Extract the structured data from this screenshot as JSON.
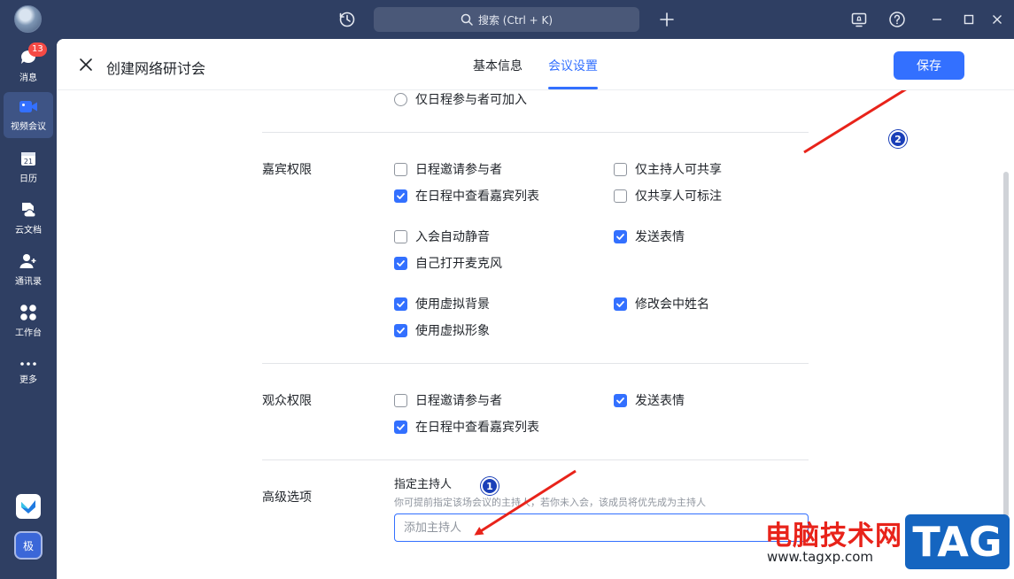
{
  "titlebar": {
    "search_label": "搜索 (Ctrl + K)"
  },
  "sidebar": {
    "badge_count": "13",
    "items": [
      {
        "label": "消息",
        "icon": "chat-icon"
      },
      {
        "label": "视频会议",
        "icon": "video-icon"
      },
      {
        "label": "日历",
        "icon": "calendar-icon"
      },
      {
        "label": "云文档",
        "icon": "cloud-doc-icon"
      },
      {
        "label": "通讯录",
        "icon": "contacts-icon"
      },
      {
        "label": "工作台",
        "icon": "apps-grid-icon"
      },
      {
        "label": "更多",
        "icon": "more-icon"
      }
    ],
    "app_tile_2_label": "极"
  },
  "header": {
    "title": "创建网络研讨会",
    "tabs": [
      {
        "label": "基本信息",
        "active": false
      },
      {
        "label": "会议设置",
        "active": true
      }
    ],
    "save_label": "保存"
  },
  "settings": {
    "top_radio_label": "仅日程参与者可加入",
    "guest": {
      "label": "嘉宾权限",
      "options": [
        {
          "label": "日程邀请参与者",
          "checked": false
        },
        {
          "label": "仅主持人可共享",
          "checked": false
        },
        {
          "label": "在日程中查看嘉宾列表",
          "checked": true
        },
        {
          "label": "仅共享人可标注",
          "checked": false
        },
        {
          "label": "入会自动静音",
          "checked": false
        },
        {
          "label": "发送表情",
          "checked": true
        },
        {
          "label": "自己打开麦克风",
          "checked": true
        },
        {
          "label": "使用虚拟背景",
          "checked": true
        },
        {
          "label": "修改会中姓名",
          "checked": true
        },
        {
          "label": "使用虚拟形象",
          "checked": true
        }
      ]
    },
    "audience": {
      "label": "观众权限",
      "options": [
        {
          "label": "日程邀请参与者",
          "checked": false
        },
        {
          "label": "发送表情",
          "checked": true
        },
        {
          "label": "在日程中查看嘉宾列表",
          "checked": true
        }
      ]
    },
    "advanced": {
      "label": "高级选项",
      "host_label": "指定主持人",
      "host_hint": "你可提前指定该场会议的主持人，若你未入会，该成员将优先成为主持人",
      "host_placeholder": "添加主持人"
    }
  },
  "annotations": {
    "step1": "1",
    "step2": "2",
    "arrow_color": "#e8231a"
  },
  "watermark": {
    "text": "电脑技术网",
    "url": "www.tagxp.com",
    "tag": "TAG"
  },
  "colors": {
    "accent": "#3370ff",
    "sidebar_bg": "#2f3f63"
  }
}
